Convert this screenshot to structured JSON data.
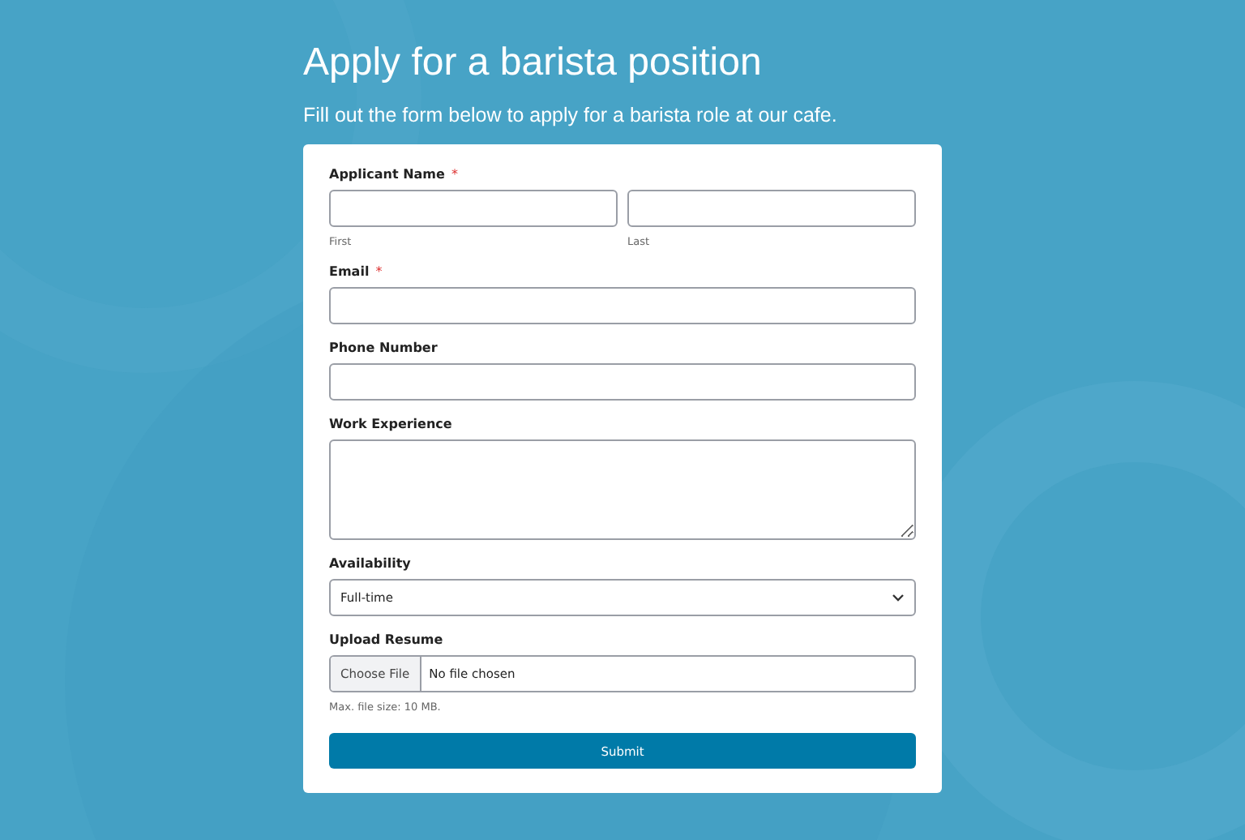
{
  "page": {
    "title": "Apply for a barista position",
    "subtitle": "Fill out the form below to apply for a barista role at our cafe."
  },
  "form": {
    "fields": [
      {
        "kind": "name",
        "label": "Applicant Name",
        "required_mark": "*",
        "sublabels": [
          "First",
          "Last"
        ]
      },
      {
        "kind": "text",
        "label": "Email",
        "required_mark": "*"
      },
      {
        "kind": "text",
        "label": "Phone Number"
      },
      {
        "kind": "textarea",
        "label": "Work Experience"
      },
      {
        "kind": "select",
        "label": "Availability",
        "value": "Full-time"
      },
      {
        "kind": "file",
        "label": "Upload Resume",
        "button": "Choose File",
        "value": "No file chosen",
        "hint": "Max. file size: 10 MB."
      }
    ],
    "submit": "Submit"
  }
}
